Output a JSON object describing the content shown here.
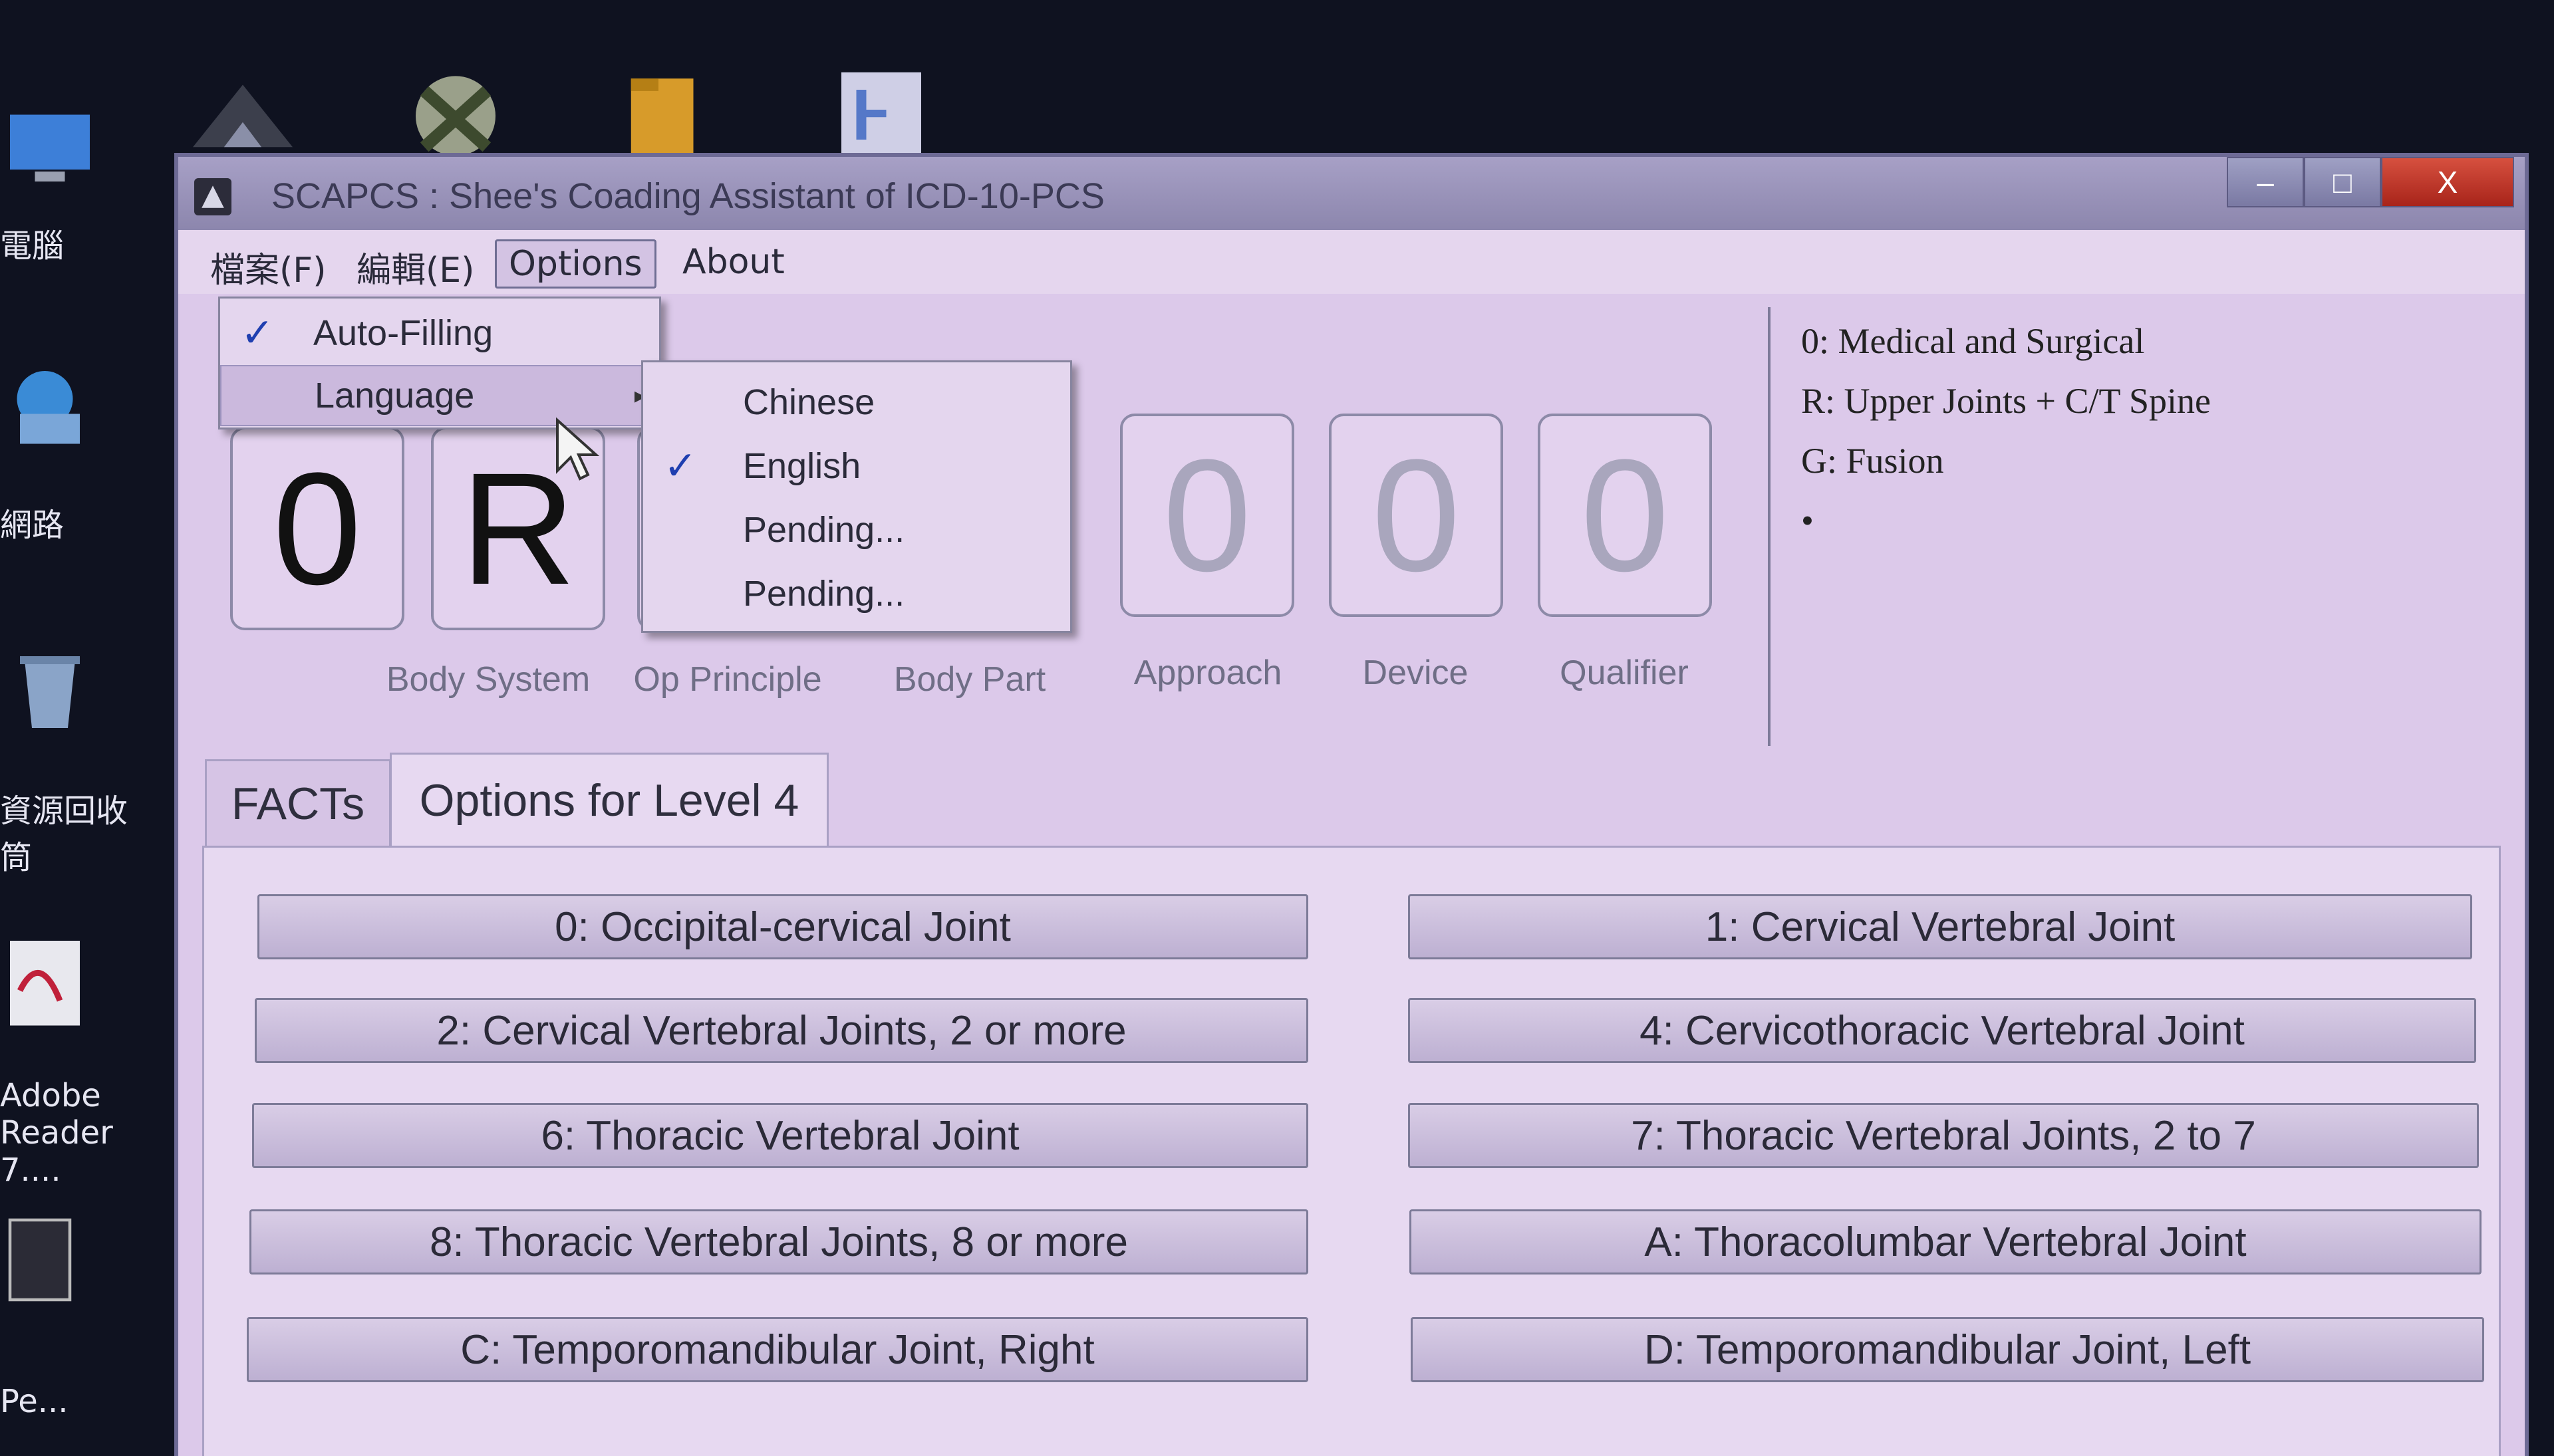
{
  "window": {
    "title": "SCAPCS : Shee's Coading Assistant of ICD-10-PCS",
    "controls": {
      "minimize": "–",
      "maximize": "□",
      "close": "X"
    }
  },
  "menubar": {
    "file": "檔案(F)",
    "edit": "編輯(E)",
    "options": "Options",
    "about": "About"
  },
  "options_menu": {
    "auto_filling": {
      "label": "Auto-Filling",
      "checked": true
    },
    "language": {
      "label": "Language",
      "arrow": "▸"
    },
    "check_mark": "✓"
  },
  "language_submenu": {
    "items": [
      {
        "label": "Chinese",
        "checked": false
      },
      {
        "label": "English",
        "checked": true
      },
      {
        "label": "Pending...",
        "checked": false
      },
      {
        "label": "Pending...",
        "checked": false
      }
    ]
  },
  "code_boxes": [
    {
      "value": "0",
      "label": ""
    },
    {
      "value": "R",
      "label": "Body System"
    },
    {
      "value": "",
      "label": "Op Principle"
    },
    {
      "value": "",
      "label": "Body Part"
    },
    {
      "value": "0",
      "label": "Approach"
    },
    {
      "value": "0",
      "label": "Device"
    },
    {
      "value": "0",
      "label": "Qualifier"
    }
  ],
  "description": {
    "lines": [
      "0: Medical and Surgical",
      "R: Upper Joints + C/T Spine",
      "G: Fusion"
    ],
    "bullet": "•"
  },
  "tabs": [
    {
      "label": "FACTs",
      "selected": false
    },
    {
      "label": "Options for Level 4",
      "selected": true
    }
  ],
  "options": [
    "0: Occipital-cervical Joint",
    "1: Cervical Vertebral Joint",
    "2: Cervical Vertebral Joints, 2 or more",
    "4: Cervicothoracic Vertebral Joint",
    "6: Thoracic Vertebral Joint",
    "7: Thoracic Vertebral Joints, 2 to 7",
    "8: Thoracic Vertebral Joints, 8 or more",
    "A: Thoracolumbar Vertebral Joint",
    "C: Temporomandibular Joint, Right",
    "D: Temporomandibular Joint, Left"
  ],
  "desktop": {
    "left_labels": [
      "電腦",
      "網路",
      "資源回收筒",
      "Adobe Reader 7....",
      "Pe..."
    ]
  },
  "colors": {
    "window_bg": "#dcc9ea",
    "titlebar": "#8c86ad",
    "close_button": "#c0392b",
    "check": "#1f3fb0"
  }
}
